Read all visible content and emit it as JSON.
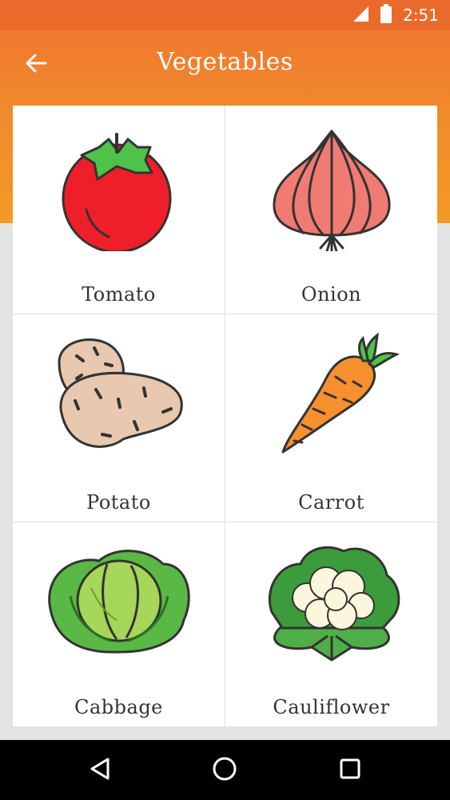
{
  "status_bar": {
    "time": "2:51",
    "signal_icon": "signal-icon",
    "battery_icon": "battery-icon"
  },
  "app_bar": {
    "title": "Vegetables",
    "back_icon": "arrow-back-icon"
  },
  "colors": {
    "header_top": "#ef7230",
    "header_bottom": "#f29a26",
    "background": "#e4e4e4",
    "card": "#ffffff",
    "nav": "#000000"
  },
  "items": [
    {
      "label": "Tomato",
      "icon": "tomato-icon"
    },
    {
      "label": "Onion",
      "icon": "onion-icon"
    },
    {
      "label": "Potato",
      "icon": "potato-icon"
    },
    {
      "label": "Carrot",
      "icon": "carrot-icon"
    },
    {
      "label": "Cabbage",
      "icon": "cabbage-icon"
    },
    {
      "label": "Cauliflower",
      "icon": "cauliflower-icon"
    }
  ],
  "nav_bar": {
    "back_icon": "nav-back-icon",
    "home_icon": "nav-home-icon",
    "recents_icon": "nav-recents-icon"
  }
}
